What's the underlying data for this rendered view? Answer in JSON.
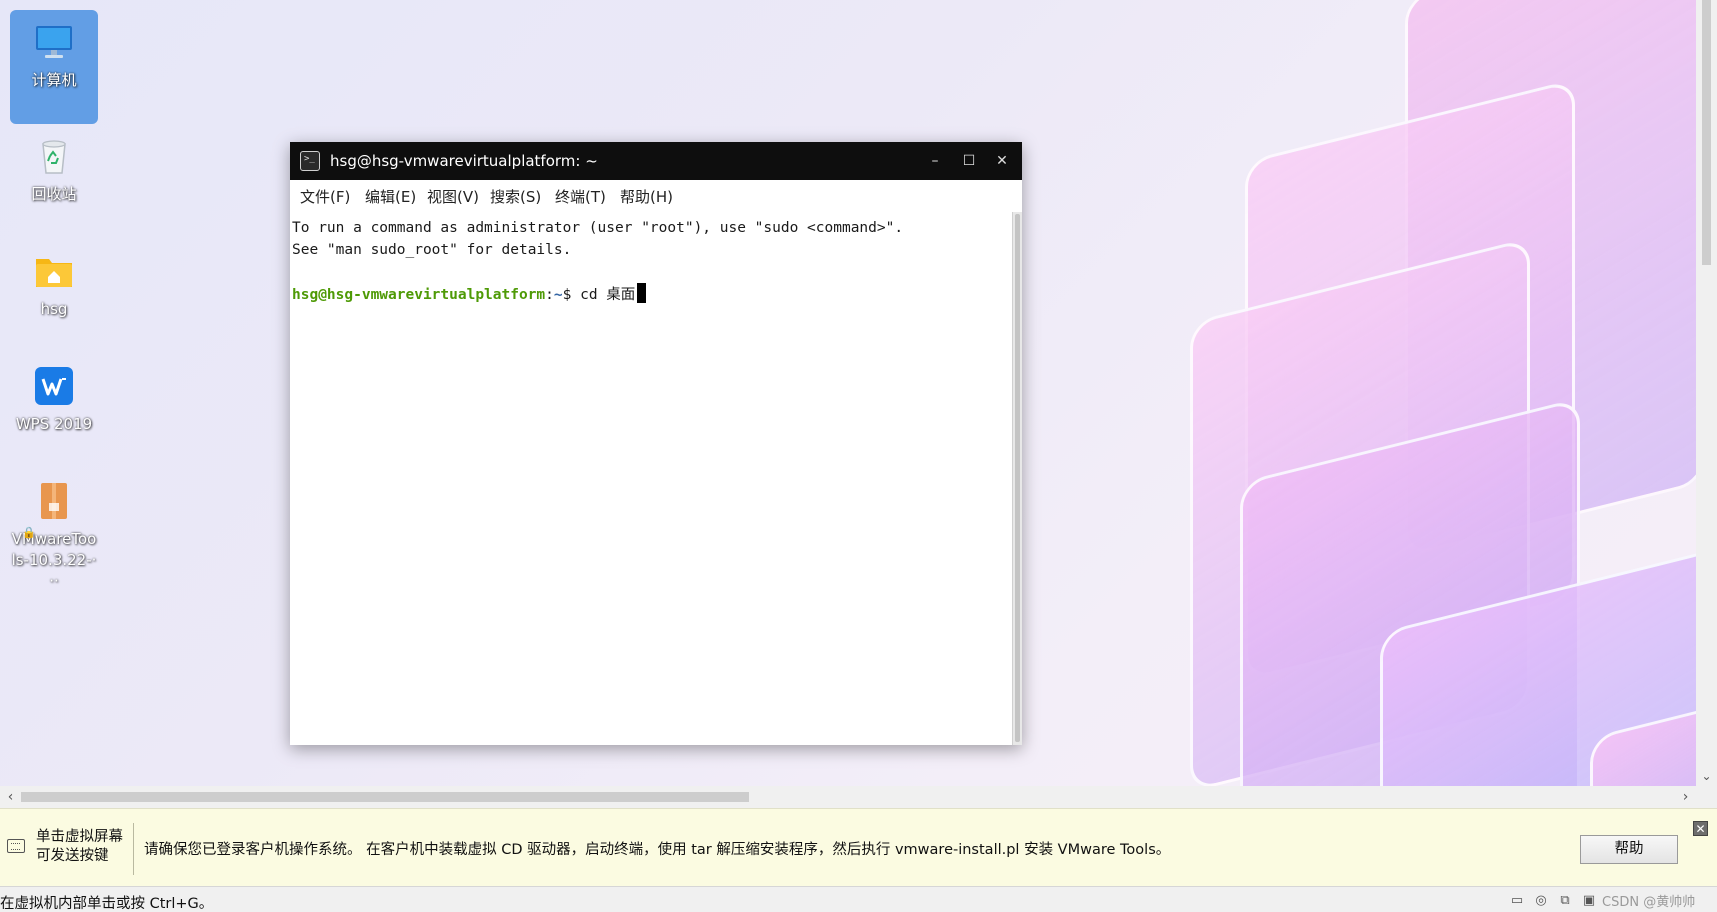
{
  "desktop": {
    "icons": [
      {
        "label": "计算机",
        "icon": "computer-icon"
      },
      {
        "label": "回收站",
        "icon": "recycle-bin-icon"
      },
      {
        "label": "hsg",
        "icon": "home-folder-icon"
      },
      {
        "label": "WPS 2019",
        "icon": "wps-icon"
      },
      {
        "label": "VMwareTools-10.3.22-···",
        "icon": "package-icon"
      }
    ]
  },
  "terminal": {
    "title": "hsg@hsg-vmwarevirtualplatform: ~",
    "controls": {
      "minimize": "–",
      "maximize": "☐",
      "close": "✕"
    },
    "menu": [
      "文件(F)",
      "编辑(E)",
      "视图(V)",
      "搜索(S)",
      "终端(T)",
      "帮助(H)"
    ],
    "lines": [
      "To run a command as administrator (user \"root\"), use \"sudo <command>\".",
      "See \"man sudo_root\" for details."
    ],
    "prompt": {
      "user_host": "hsg@hsg-vmwarevirtualplatform",
      "sep": ":",
      "path": "~",
      "symbol": "$ ",
      "command": "cd 桌面"
    }
  },
  "scrollbars": {
    "left_arrow": "‹",
    "right_arrow": "›",
    "down_arrow": "⌄"
  },
  "hint_bar": {
    "left_line1": "单击虚拟屏幕",
    "left_line2": "可发送按键",
    "message": "请确保您已登录客户机操作系统。 在客户机中装载虚拟 CD 驱动器，启动终端，使用 tar 解压缩安装程序，然后执行 vmware-install.pl 安装 VMware Tools。",
    "help_button": "帮助",
    "close": "✕"
  },
  "status_bar": {
    "text": "在虚拟机内部单击或按 Ctrl+G。",
    "watermark": "CSDN @黄帅帅"
  }
}
